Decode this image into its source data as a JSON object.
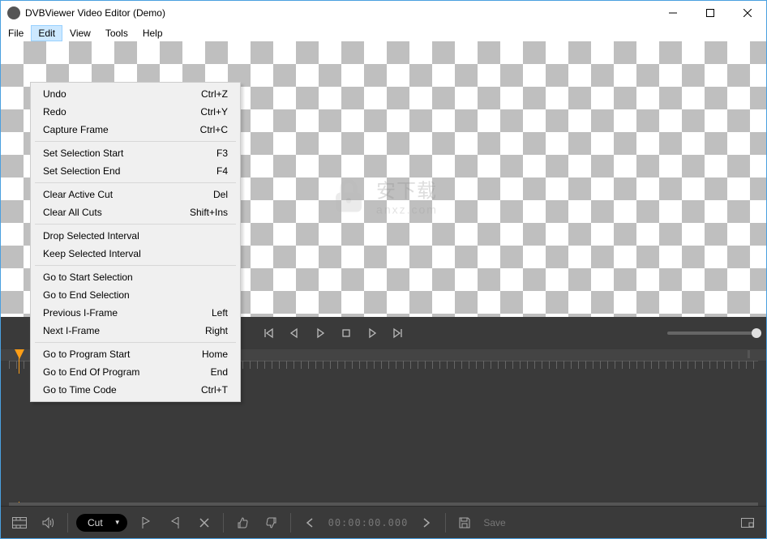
{
  "window": {
    "title": "DVBViewer Video Editor (Demo)"
  },
  "menubar": {
    "items": [
      "File",
      "Edit",
      "View",
      "Tools",
      "Help"
    ],
    "active_index": 1
  },
  "edit_menu": {
    "groups": [
      [
        {
          "label": "Undo",
          "shortcut": "Ctrl+Z"
        },
        {
          "label": "Redo",
          "shortcut": "Ctrl+Y"
        },
        {
          "label": "Capture Frame",
          "shortcut": "Ctrl+C"
        }
      ],
      [
        {
          "label": "Set Selection Start",
          "shortcut": "F3"
        },
        {
          "label": "Set Selection End",
          "shortcut": "F4"
        }
      ],
      [
        {
          "label": "Clear Active Cut",
          "shortcut": "Del"
        },
        {
          "label": "Clear All Cuts",
          "shortcut": "Shift+Ins"
        }
      ],
      [
        {
          "label": "Drop Selected Interval",
          "shortcut": ""
        },
        {
          "label": "Keep Selected Interval",
          "shortcut": ""
        }
      ],
      [
        {
          "label": "Go to Start Selection",
          "shortcut": ""
        },
        {
          "label": "Go to End Selection",
          "shortcut": ""
        },
        {
          "label": "Previous I-Frame",
          "shortcut": "Left"
        },
        {
          "label": "Next I-Frame",
          "shortcut": "Right"
        }
      ],
      [
        {
          "label": "Go to Program Start",
          "shortcut": "Home"
        },
        {
          "label": "Go to End Of Program",
          "shortcut": "End"
        },
        {
          "label": "Go to Time Code",
          "shortcut": "Ctrl+T"
        }
      ]
    ]
  },
  "watermark": {
    "text": "安下载",
    "sub": "anxz.com"
  },
  "toolbar": {
    "cut_label": "Cut",
    "timecode": "00:00:00.000",
    "save_label": "Save"
  }
}
